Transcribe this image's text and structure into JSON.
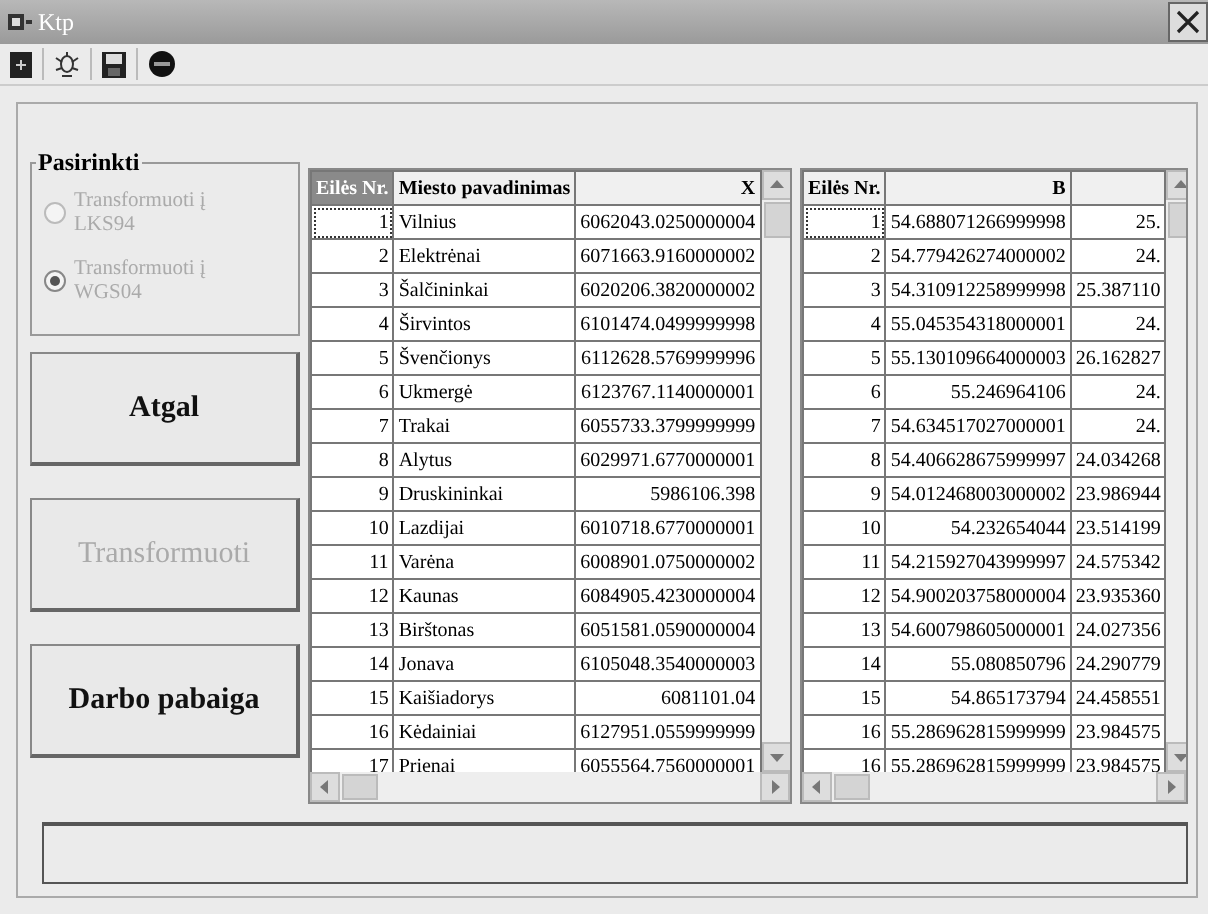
{
  "window": {
    "title": "Ktp"
  },
  "group": {
    "title": "Pasirinkti",
    "options": [
      {
        "label": "Transformuoti į LKS94",
        "selected": false,
        "disabled": true
      },
      {
        "label": "Transformuoti į WGS04",
        "selected": true,
        "disabled": true
      }
    ]
  },
  "buttons": [
    {
      "label": "Atgal",
      "disabled": false
    },
    {
      "label": "Transformuoti",
      "disabled": true
    },
    {
      "label": "Darbo pabaiga",
      "disabled": false
    }
  ],
  "left_table": {
    "columns": [
      "Eilės Nr.",
      "Miesto pavadinimas",
      "X"
    ],
    "rows": [
      [
        "1",
        "Vilnius",
        "6062043.0250000004"
      ],
      [
        "2",
        "Elektrėnai",
        "6071663.9160000002"
      ],
      [
        "3",
        "Šalčininkai",
        "6020206.3820000002"
      ],
      [
        "4",
        "Širvintos",
        "6101474.0499999998"
      ],
      [
        "5",
        "Švenčionys",
        "6112628.5769999996"
      ],
      [
        "6",
        "Ukmergė",
        "6123767.1140000001"
      ],
      [
        "7",
        "Trakai",
        "6055733.3799999999"
      ],
      [
        "8",
        "Alytus",
        "6029971.6770000001"
      ],
      [
        "9",
        "Druskininkai",
        "5986106.398"
      ],
      [
        "10",
        "Lazdijai",
        "6010718.6770000001"
      ],
      [
        "11",
        "Varėna",
        "6008901.0750000002"
      ],
      [
        "12",
        "Kaunas",
        "6084905.4230000004"
      ],
      [
        "13",
        "Birštonas",
        "6051581.0590000004"
      ],
      [
        "14",
        "Jonava",
        "6105048.3540000003"
      ],
      [
        "15",
        "Kaišiadorys",
        "6081101.04"
      ],
      [
        "16",
        "Kėdainiai",
        "6127951.0559999999"
      ],
      [
        "17",
        "Prienai",
        "6055564.7560000001"
      ]
    ]
  },
  "right_table": {
    "columns": [
      "Eilės Nr.",
      "B"
    ],
    "rows": [
      [
        "1",
        "54.688071266999998",
        "25."
      ],
      [
        "2",
        "54.779426274000002",
        "24."
      ],
      [
        "3",
        "54.310912258999998",
        "25.387110"
      ],
      [
        "4",
        "55.045354318000001",
        "24."
      ],
      [
        "5",
        "55.130109664000003",
        "26.162827"
      ],
      [
        "6",
        "55.246964106",
        "24."
      ],
      [
        "7",
        "54.634517027000001",
        "24."
      ],
      [
        "8",
        "54.406628675999997",
        "24.034268"
      ],
      [
        "9",
        "54.012468003000002",
        "23.986944"
      ],
      [
        "10",
        "54.232654044",
        "23.514199"
      ],
      [
        "11",
        "54.215927043999997",
        "24.575342"
      ],
      [
        "12",
        "54.900203758000004",
        "23.935360"
      ],
      [
        "13",
        "54.600798605000001",
        "24.027356"
      ],
      [
        "14",
        "55.080850796",
        "24.290779"
      ],
      [
        "15",
        "54.865173794",
        "24.458551"
      ],
      [
        "16",
        "55.286962815999999",
        "23.984575"
      ],
      [
        "16",
        "55.286962815999999",
        "23.984575"
      ]
    ]
  }
}
